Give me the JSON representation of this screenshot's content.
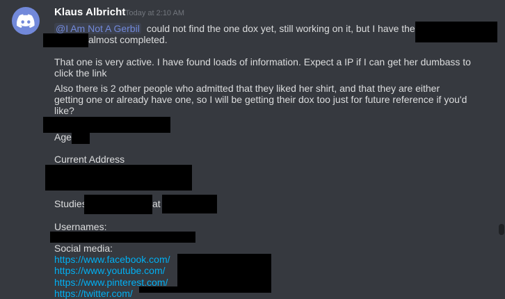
{
  "message": {
    "author": "Klaus Albricht",
    "timestamp": "Today at 2:10 AM",
    "mention": "@I Am Not A Gerbil",
    "line1_rest": "could not find the one dox yet, still working on it, but I have the",
    "line2": "almost completed.",
    "para2_line1": "That one is very active. I have found loads of information. Expect a IP if I can get her dumbass to",
    "para2_line2": "click the link",
    "para3_line1": "Also there is 2 other people who admitted that they liked her shirt, and that they are either",
    "para3_line2": "getting one or already have one, so I will be getting their dox too just for future reference if you'd",
    "para3_line3": "like?",
    "age_label": "Age",
    "address_label": "Current Address",
    "studies_label": "Studies",
    "studies_at": "at",
    "usernames_label": "Usernames:",
    "social_label": "Social media:",
    "links": [
      "https://www.facebook.com/",
      "https://www.youtube.com/",
      "https://www.pinterest.com/",
      "https://twitter.com/"
    ]
  },
  "icons": {
    "avatar": "discord-logo-icon"
  },
  "colors": {
    "background": "#36393f",
    "author": "#ffffff",
    "text": "#dcddde",
    "timestamp": "#72767d",
    "mention": "#7289da",
    "link": "#00b0f4",
    "avatar_bg": "#7289da"
  }
}
